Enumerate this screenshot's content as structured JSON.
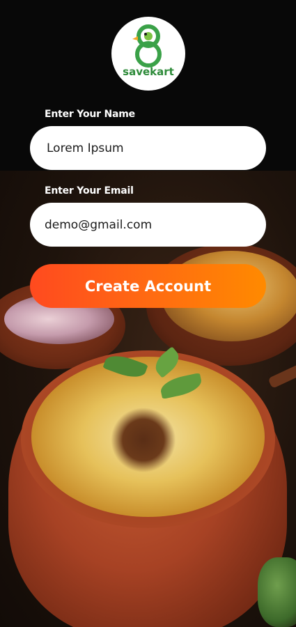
{
  "brand": {
    "name": "savekart",
    "color": "#2e8b3a"
  },
  "form": {
    "name_label": "Enter Your Name",
    "name_value": "Lorem Ipsum",
    "email_label": "Enter Your  Email",
    "email_value": "demo@gmail.com"
  },
  "actions": {
    "create_account_label": "Create Account"
  },
  "colors": {
    "cta_start": "#ff4a1f",
    "cta_end": "#ff8a00",
    "field_bg": "#ffffff"
  }
}
